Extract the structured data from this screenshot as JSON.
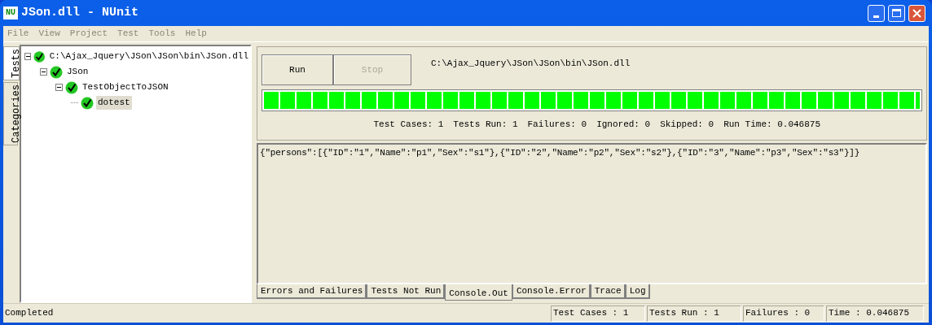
{
  "window": {
    "title": "JSon.dll - NUnit",
    "app_icon": "NU"
  },
  "menu": [
    "File",
    "View",
    "Project",
    "Test",
    "Tools",
    "Help"
  ],
  "side_tabs": [
    {
      "label": "Tests",
      "selected": true
    },
    {
      "label": "Categories",
      "selected": false
    }
  ],
  "tree": [
    {
      "label": "C:\\Ajax_Jquery\\JSon\\JSon\\bin\\JSon.dll",
      "expanded": true,
      "selected": false,
      "children": [
        {
          "label": "JSon",
          "expanded": true,
          "selected": false,
          "children": [
            {
              "label": "TestObjectToJSON",
              "expanded": true,
              "selected": false,
              "children": [
                {
                  "label": "dotest",
                  "selected": true
                }
              ]
            }
          ]
        }
      ]
    }
  ],
  "buttons": [
    {
      "label": "Run",
      "disabled": false
    },
    {
      "label": "Stop",
      "disabled": true
    }
  ],
  "assembly_path": "C:\\Ajax_Jquery\\JSon\\JSon\\bin\\JSon.dll",
  "progress": {
    "level": 1
  },
  "summary": [
    "Test Cases: 1",
    "Tests Run: 1",
    "Failures: 0",
    "Ignored: 0",
    "Skipped: 0",
    "Run Time: 0.046875"
  ],
  "console_output": "{\"persons\":[{\"ID\":\"1\",\"Name\":\"p1\",\"Sex\":\"s1\"},{\"ID\":\"2\",\"Name\":\"p2\",\"Sex\":\"s2\"},{\"ID\":\"3\",\"Name\":\"p3\",\"Sex\":\"s3\"}]}",
  "output_tabs": [
    {
      "label": "Errors and Failures",
      "selected": false
    },
    {
      "label": "Tests Not Run",
      "selected": false
    },
    {
      "label": "Console.Out",
      "selected": true
    },
    {
      "label": "Console.Error",
      "selected": false
    },
    {
      "label": "Trace",
      "selected": false
    },
    {
      "label": "Log",
      "selected": false
    }
  ],
  "status_bar": {
    "message": "Completed",
    "panels": [
      "Test Cases : 1",
      "Tests Run : 1",
      "Failures : 0",
      "Time : 0.046875"
    ]
  }
}
